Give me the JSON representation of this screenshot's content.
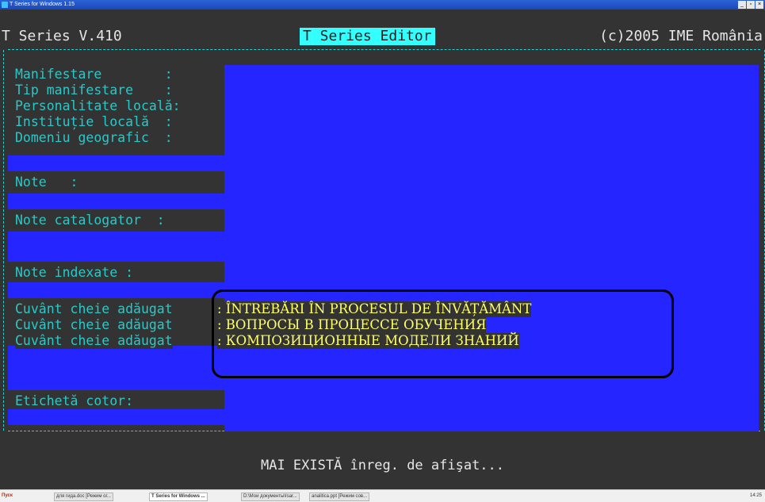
{
  "window": {
    "title": "T Series for Windows 1.15",
    "controls": [
      "_",
      "4",
      "x"
    ]
  },
  "header": {
    "version": "T Series V.410",
    "editor_title": "T Series Editor",
    "copyright": "(c)2005 IME România"
  },
  "fields": [
    {
      "label": "Manifestare        :"
    },
    {
      "label": "Tip manifestare    :"
    },
    {
      "label": "Personalitate locală:"
    },
    {
      "label": "Instituție locală  :"
    },
    {
      "label": "Domeniu geografic  :"
    },
    {
      "label": "Note   :"
    },
    {
      "label": "Note catalogator  :"
    },
    {
      "label": "Note indexate :"
    }
  ],
  "keywords": {
    "label": "Cuvânt cheie adăugat",
    "values": [
      ": ÎNTREBĂRI ÎN PROCESUL DE ÎNVĂȚĂMÂNT",
      ": ВОПРОСЫ В ПРОЦЕССЕ ОБУЧЕНИЯ",
      ": КОМПОЗИЦИОННЫЕ МОДЕЛИ ЗНАНИЙ"
    ]
  },
  "spine_label": "Etichetă cotor:",
  "status_message": "MAI EXISTĂ înreg. de afişat...",
  "taskbar": {
    "start": "Пуск",
    "tasks": [
      "для гида.doc [Режим ог...",
      "T Series for Windows ...",
      "D:\\Мои документы\\Isar...",
      "analitica.ppt [Режим сов..."
    ],
    "clock": "14:25"
  },
  "colors": {
    "console_bg": "#333333",
    "field_bg": "#2525ff",
    "label": "#2ac8c8",
    "keyword": "#ffff66",
    "title_highlight": "#33ffff"
  }
}
